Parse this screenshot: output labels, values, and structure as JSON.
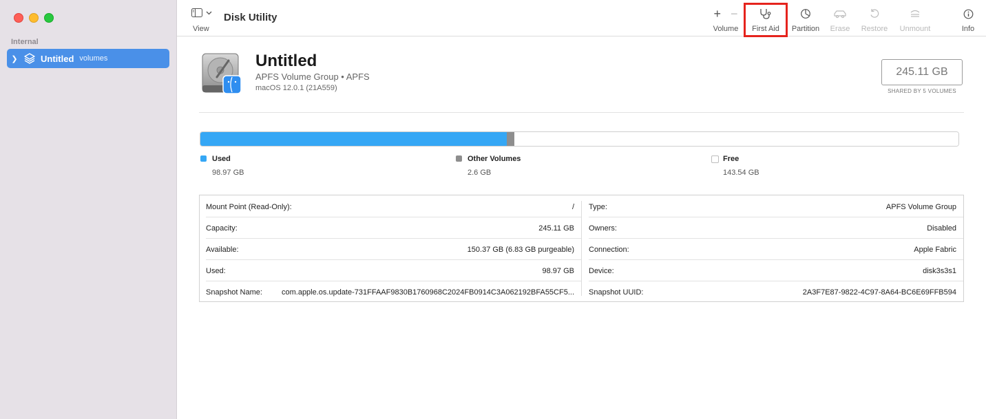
{
  "window": {
    "title": "Disk Utility"
  },
  "sidebar": {
    "section": "Internal",
    "items": [
      {
        "label": "Untitled",
        "sublabel": "volumes"
      }
    ]
  },
  "toolbar": {
    "view_label": "View",
    "buttons": [
      {
        "label": "Volume",
        "icon": "plus-minus-icon",
        "enabled": true
      },
      {
        "label": "First Aid",
        "icon": "stethoscope-icon",
        "enabled": true,
        "highlighted": true
      },
      {
        "label": "Partition",
        "icon": "pie-icon",
        "enabled": true
      },
      {
        "label": "Erase",
        "icon": "car-eraser-icon",
        "enabled": false
      },
      {
        "label": "Restore",
        "icon": "restore-icon",
        "enabled": false
      },
      {
        "label": "Unmount",
        "icon": "eject-icon",
        "enabled": false
      },
      {
        "label": "Info",
        "icon": "info-icon",
        "enabled": true
      }
    ],
    "plus": "+",
    "minus": "−"
  },
  "disk": {
    "name": "Untitled",
    "type": "APFS Volume Group • APFS",
    "os": "macOS 12.0.1 (21A559)",
    "size": "245.11 GB",
    "size_note": "SHARED BY 5 VOLUMES"
  },
  "usage": {
    "total_gb": 245.11,
    "segments": [
      {
        "name": "Used",
        "value": "98.97 GB",
        "gb": 98.97,
        "color": "#35a7f5"
      },
      {
        "name": "Other Volumes",
        "value": "2.6 GB",
        "gb": 2.6,
        "color": "#8e8e8e"
      },
      {
        "name": "Free",
        "value": "143.54 GB",
        "gb": 143.54,
        "color": "#ffffff"
      }
    ]
  },
  "info": {
    "left": [
      {
        "key": "Mount Point (Read-Only):",
        "value": "/"
      },
      {
        "key": "Capacity:",
        "value": "245.11 GB"
      },
      {
        "key": "Available:",
        "value": "150.37 GB (6.83 GB purgeable)"
      },
      {
        "key": "Used:",
        "value": "98.97 GB"
      },
      {
        "key": "Snapshot Name:",
        "value": "com.apple.os.update-731FFAAF9830B1760968C2024FB0914C3A062192BFA55CF5..."
      }
    ],
    "right": [
      {
        "key": "Type:",
        "value": "APFS Volume Group"
      },
      {
        "key": "Owners:",
        "value": "Disabled"
      },
      {
        "key": "Connection:",
        "value": "Apple Fabric"
      },
      {
        "key": "Device:",
        "value": "disk3s3s1"
      },
      {
        "key": "Snapshot UUID:",
        "value": "2A3F7E87-9822-4C97-8A64-BC6E69FFB594"
      }
    ]
  }
}
